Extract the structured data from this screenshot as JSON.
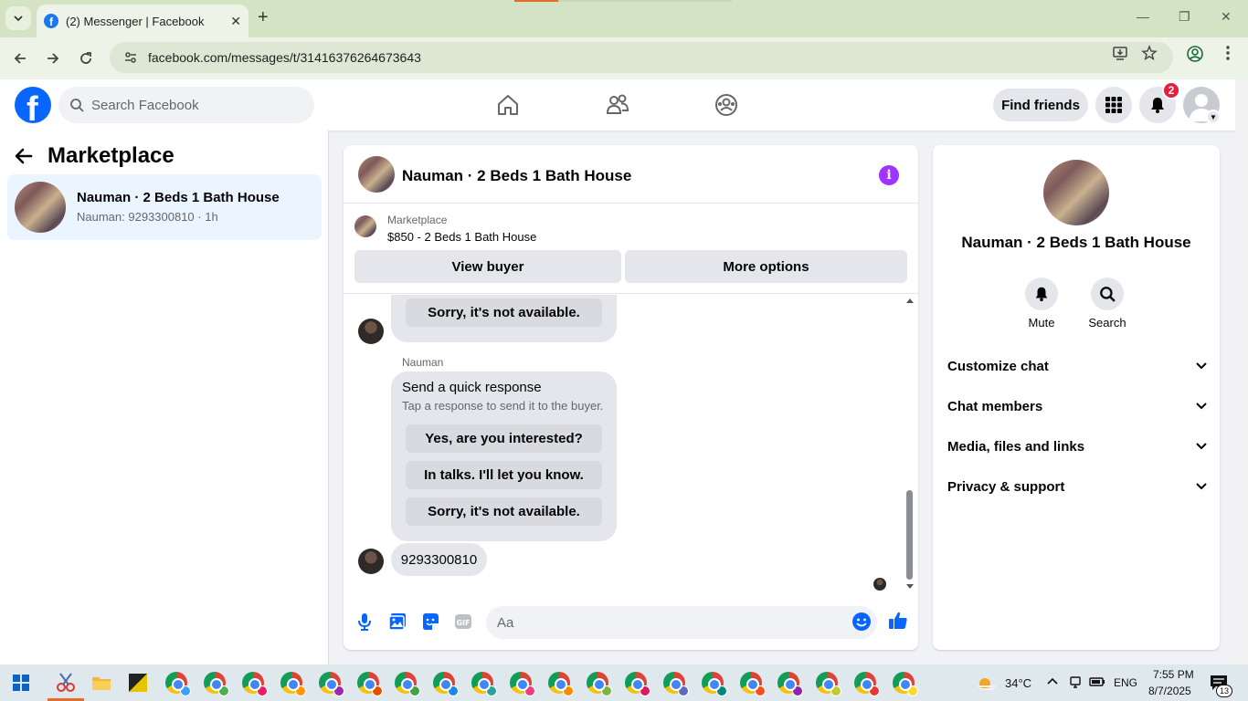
{
  "browser": {
    "tab_title": "(2) Messenger | Facebook",
    "url": "facebook.com/messages/t/31416376264673643"
  },
  "fb_header": {
    "search_placeholder": "Search Facebook",
    "find_friends_label": "Find friends",
    "notification_count": "2"
  },
  "sidebar": {
    "title": "Marketplace",
    "conversation": {
      "name": "Nauman · 2 Beds 1 Bath House",
      "preview": "Nauman: 9293300810 · 1h"
    }
  },
  "chat": {
    "title": "Nauman · 2 Beds 1 Bath House",
    "listing_label": "Marketplace",
    "listing_price": "$850 - 2 Beds 1 Bath House",
    "view_buyer_label": "View buyer",
    "more_options_label": "More options",
    "messages": {
      "first_reply": "Sorry, it's not available.",
      "sender": "Nauman",
      "quick_title": "Send a quick response",
      "quick_sub": "Tap a response to send it to the buyer.",
      "quick_options": [
        "Yes, are you interested?",
        "In talks. I'll let you know.",
        "Sorry, it's not available."
      ],
      "phone_message": "9293300810"
    },
    "composer_placeholder": "Aa"
  },
  "info_panel": {
    "name": "Nauman · 2 Beds 1 Bath House",
    "mute_label": "Mute",
    "search_label": "Search",
    "sections": [
      "Customize chat",
      "Chat members",
      "Media, files and links",
      "Privacy & support"
    ]
  },
  "taskbar": {
    "temperature": "34°C",
    "language": "ENG",
    "time": "7:55 PM",
    "date": "8/7/2025",
    "notification_count": "13"
  },
  "colors": {
    "fb_blue": "#0866ff",
    "messenger_accent": "#a033ff",
    "selected_conv": "#ebf5ff",
    "notification_red": "#e41e3f"
  }
}
